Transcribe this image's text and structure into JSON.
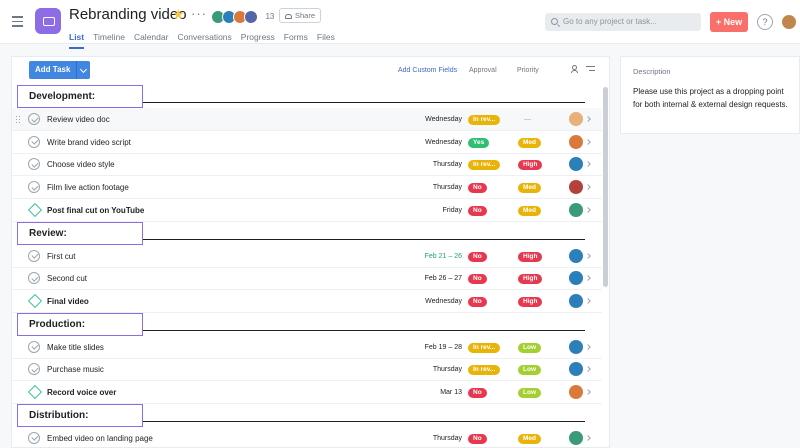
{
  "header": {
    "project_title": "Rebranding video",
    "member_count": "13",
    "share_label": "Share",
    "tabs": [
      "List",
      "Timeline",
      "Calendar",
      "Conversations",
      "Progress",
      "Forms",
      "Files"
    ],
    "active_tab": "List",
    "search_placeholder": "Go to any project or task...",
    "new_label": "+ New",
    "help_label": "?"
  },
  "toolbar": {
    "add_task_label": "Add Task",
    "add_custom_fields_label": "Add Custom Fields",
    "approval_label": "Approval",
    "priority_label": "Priority"
  },
  "colors": {
    "in_review": "#eab308",
    "yes": "#2fbf71",
    "no": "#e8384f",
    "med": "#eab308",
    "high": "#e8384f",
    "low": "#a4cf30",
    "accent": "#4186e0",
    "project": "#8d6ce6"
  },
  "sections": [
    {
      "name": "Development:",
      "tasks": [
        {
          "title": "Review video doc",
          "date": "Wednesday",
          "approval": "In rev...",
          "approval_color": "#eab308",
          "priority": "—",
          "priority_color": "",
          "milestone": false,
          "highlighted": true,
          "avatar_color": "#e8b07a"
        },
        {
          "title": "Write brand video script",
          "date": "Wednesday",
          "approval": "Yes",
          "approval_color": "#2fbf71",
          "priority": "Med",
          "priority_color": "#eab308",
          "milestone": false,
          "highlighted": false,
          "avatar_color": "#d97a3b"
        },
        {
          "title": "Choose video style",
          "date": "Thursday",
          "approval": "In rev...",
          "approval_color": "#eab308",
          "priority": "High",
          "priority_color": "#e8384f",
          "milestone": false,
          "highlighted": false,
          "avatar_color": "#2c7fb8"
        },
        {
          "title": "Film live action footage",
          "date": "Thursday",
          "approval": "No",
          "approval_color": "#e8384f",
          "priority": "Med",
          "priority_color": "#eab308",
          "milestone": false,
          "highlighted": false,
          "avatar_color": "#b5413c"
        },
        {
          "title": "Post final cut on YouTube",
          "date": "Friday",
          "approval": "No",
          "approval_color": "#e8384f",
          "priority": "Med",
          "priority_color": "#eab308",
          "milestone": true,
          "highlighted": false,
          "avatar_color": "#3a9a7a"
        }
      ]
    },
    {
      "name": "Review:",
      "tasks": [
        {
          "title": "First cut",
          "date": "Feb 21 – 26",
          "date_green": true,
          "approval": "No",
          "approval_color": "#e8384f",
          "priority": "High",
          "priority_color": "#e8384f",
          "milestone": false,
          "highlighted": false,
          "avatar_color": "#2c7fb8"
        },
        {
          "title": "Second cut",
          "date": "Feb 26 – 27",
          "approval": "No",
          "approval_color": "#e8384f",
          "priority": "High",
          "priority_color": "#e8384f",
          "milestone": false,
          "highlighted": false,
          "avatar_color": "#2c7fb8"
        },
        {
          "title": "Final video",
          "date": "Wednesday",
          "approval": "No",
          "approval_color": "#e8384f",
          "priority": "High",
          "priority_color": "#e8384f",
          "milestone": true,
          "highlighted": false,
          "avatar_color": "#2c7fb8"
        }
      ]
    },
    {
      "name": "Production:",
      "tasks": [
        {
          "title": "Make title slides",
          "date": "Feb 19 – 28",
          "approval": "In rev...",
          "approval_color": "#eab308",
          "priority": "Low",
          "priority_color": "#a4cf30",
          "milestone": false,
          "highlighted": false,
          "avatar_color": "#2c7fb8"
        },
        {
          "title": "Purchase music",
          "date": "Thursday",
          "approval": "In rev...",
          "approval_color": "#eab308",
          "priority": "Low",
          "priority_color": "#a4cf30",
          "milestone": false,
          "highlighted": false,
          "avatar_color": "#2c7fb8"
        },
        {
          "title": "Record voice over",
          "date": "Mar 13",
          "approval": "No",
          "approval_color": "#e8384f",
          "priority": "Low",
          "priority_color": "#a4cf30",
          "milestone": true,
          "highlighted": false,
          "avatar_color": "#d97a3b"
        }
      ]
    },
    {
      "name": "Distribution:",
      "tasks": [
        {
          "title": "Embed video on landing page",
          "date": "Thursday",
          "approval": "No",
          "approval_color": "#e8384f",
          "priority": "Med",
          "priority_color": "#eab308",
          "milestone": false,
          "highlighted": false,
          "avatar_color": "#3a9a7a"
        }
      ]
    }
  ],
  "description": {
    "heading": "Description",
    "text": "Please use this project as a dropping point for both internal & external design requests."
  }
}
